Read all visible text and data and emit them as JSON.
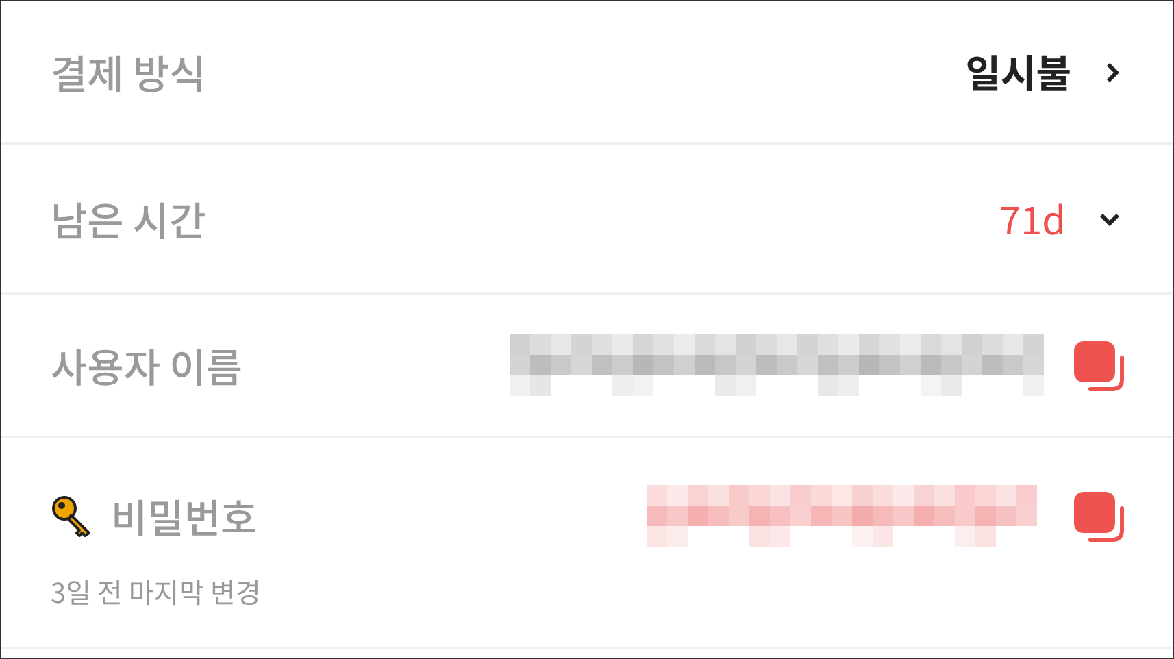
{
  "rows": [
    {
      "kind": "choice",
      "label": "결제 방식",
      "value": "일시불"
    },
    {
      "kind": "duration",
      "label": "남은 시간",
      "value": "71d",
      "expanded": false
    },
    {
      "kind": "username",
      "label": "사용자 이름",
      "color": "#b4b4b4"
    },
    {
      "kind": "password",
      "label": "비밀번호",
      "color": "#f4a8a8",
      "note": "3일 전 마지막 변경"
    }
  ]
}
